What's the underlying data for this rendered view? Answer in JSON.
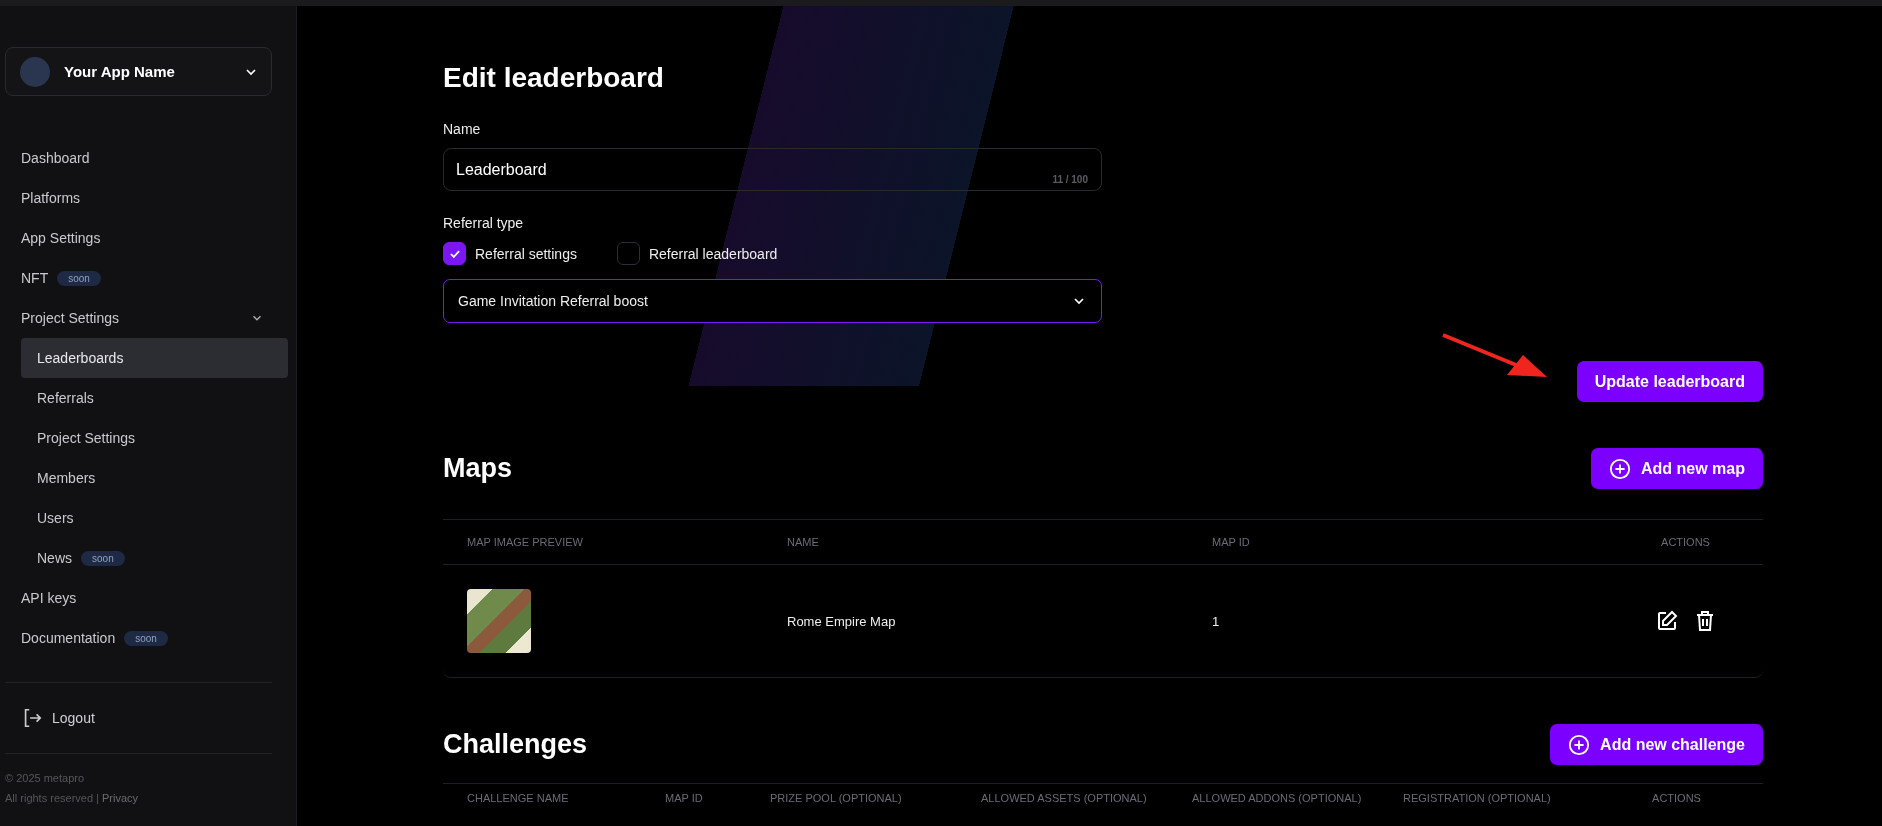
{
  "app_selector": {
    "name": "Your App Name"
  },
  "sidebar": {
    "items": [
      {
        "label": "Dashboard",
        "selected": false
      },
      {
        "label": "Platforms",
        "selected": false
      },
      {
        "label": "App Settings",
        "selected": false
      },
      {
        "label": "NFT",
        "badge": "soon",
        "selected": false
      },
      {
        "label": "Project Settings",
        "selected": false,
        "expanded": true,
        "children": [
          {
            "label": "Leaderboards",
            "selected": true
          },
          {
            "label": "Referrals",
            "selected": false
          },
          {
            "label": "Project Settings",
            "selected": false
          },
          {
            "label": "Members",
            "selected": false
          },
          {
            "label": "Users",
            "selected": false
          },
          {
            "label": "News",
            "badge": "soon",
            "selected": false
          }
        ]
      },
      {
        "label": "API keys",
        "selected": false
      },
      {
        "label": "Documentation",
        "badge": "soon",
        "selected": false
      }
    ],
    "logout": "Logout",
    "footer": {
      "copyright": "© 2025 metapro",
      "rights": "All rights reserved |",
      "privacy": "Privacy"
    }
  },
  "form": {
    "title": "Edit leaderboard",
    "name_label": "Name",
    "name_value": "Leaderboard",
    "counter": "11 / 100",
    "referral_type_label": "Referral type",
    "options": [
      {
        "label": "Referral settings",
        "checked": true
      },
      {
        "label": "Referral leaderboard",
        "checked": false
      }
    ],
    "select_value": "Game Invitation Referral boost",
    "submit": "Update leaderboard"
  },
  "maps": {
    "title": "Maps",
    "add_button": "Add new map",
    "columns": [
      "MAP IMAGE PREVIEW",
      "NAME",
      "MAP ID",
      "ACTIONS"
    ],
    "rows": [
      {
        "name": "Rome Empire Map",
        "map_id": "1"
      }
    ]
  },
  "challenges": {
    "title": "Challenges",
    "add_button": "Add new challenge",
    "columns": [
      "CHALLENGE NAME",
      "MAP ID",
      "PRIZE POOL (OPTIONAL)",
      "ALLOWED ASSETS (OPTIONAL)",
      "ALLOWED ADDONS (OPTIONAL)",
      "REGISTRATION (OPTIONAL)",
      "ACTIONS"
    ]
  }
}
